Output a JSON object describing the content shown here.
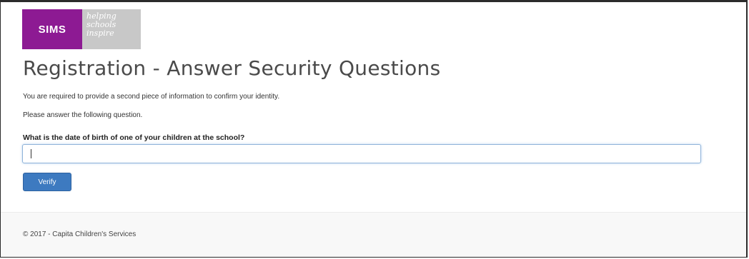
{
  "header": {
    "logo_text": "SIMS",
    "tagline": [
      "helping",
      "schools",
      "inspire"
    ]
  },
  "main": {
    "title": "Registration - Answer Security Questions",
    "intro_line": "You are required to provide a second piece of information to confirm your identity.",
    "instruction_line": "Please answer the following question.",
    "question_label": "What is the date of birth of one of your children at the school?",
    "answer_value": "",
    "verify_label": "Verify"
  },
  "footer": {
    "copyright": "© 2017 - Capita Children's Services"
  },
  "colors": {
    "brand_purple": "#8d1a93",
    "logo_grey": "#c6c6c6",
    "button_blue": "#3d7ac0",
    "input_focus_border": "#8fb3d9"
  }
}
